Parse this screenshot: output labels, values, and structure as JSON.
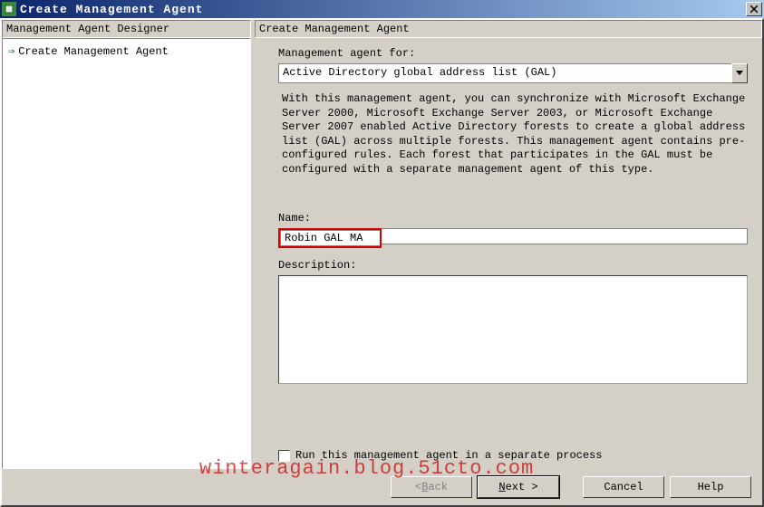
{
  "window": {
    "title": "Create Management Agent"
  },
  "left": {
    "header": "Management Agent Designer",
    "step_label": "Create Management Agent"
  },
  "right": {
    "header": "Create Management Agent",
    "ma_for_label": "Management agent for:",
    "ma_for_value": "Active Directory global address list (GAL)",
    "info_text": "With this management agent, you can synchronize with Microsoft Exchange Server 2000, Microsoft Exchange Server 2003, or Microsoft Exchange Server 2007 enabled Active Directory forests to create a global address list (GAL) across multiple forests.  This management agent contains pre-configured rules. Each forest that participates in the GAL must be configured with a separate management agent of this type.",
    "name_label": "Name:",
    "name_value": "Robin GAL MA",
    "description_label": "Description:",
    "description_value": "",
    "checkbox_label": "Run this management agent in a separate process"
  },
  "buttons": {
    "back_u": "B",
    "back_rest": "ack",
    "next_u": "N",
    "next_rest": "ext >",
    "back_prefix": "< ",
    "cancel": "Cancel",
    "help": "Help"
  },
  "watermark": "winteragain.blog.51cto.com"
}
